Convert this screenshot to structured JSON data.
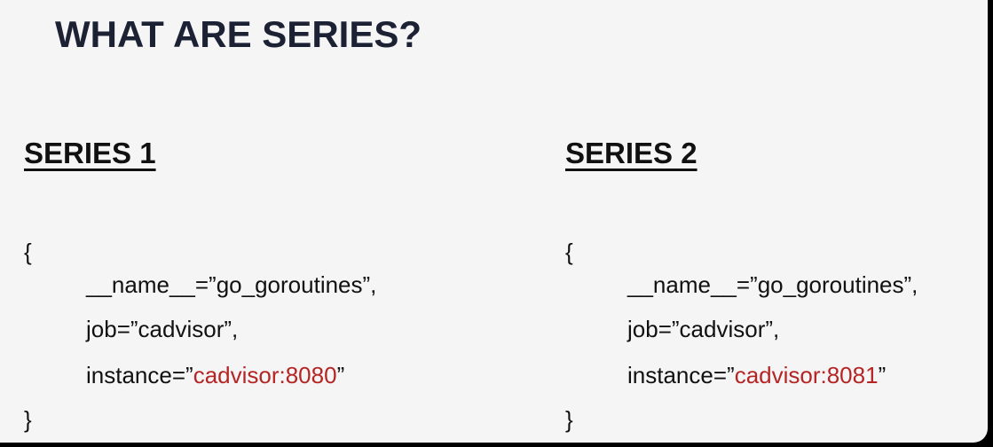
{
  "title": "WHAT ARE SERIES?",
  "series": [
    {
      "heading": "SERIES 1",
      "open_brace": "{",
      "name_line": "__name__=”go_goroutines”,",
      "job_line": "job=”cadvisor”,",
      "instance_prefix": "instance=”",
      "instance_value": "cadvisor:8080",
      "instance_suffix": "”",
      "close_brace": "}"
    },
    {
      "heading": "SERIES 2",
      "open_brace": "{",
      "name_line": "__name__=”go_goroutines”,",
      "job_line": "job=”cadvisor”,",
      "instance_prefix": "instance=”",
      "instance_value": "cadvisor:8081",
      "instance_suffix": "”",
      "close_brace": "}"
    }
  ],
  "colors": {
    "background": "#f5f5f6",
    "title": "#1c2233",
    "highlight": "#b52524"
  }
}
